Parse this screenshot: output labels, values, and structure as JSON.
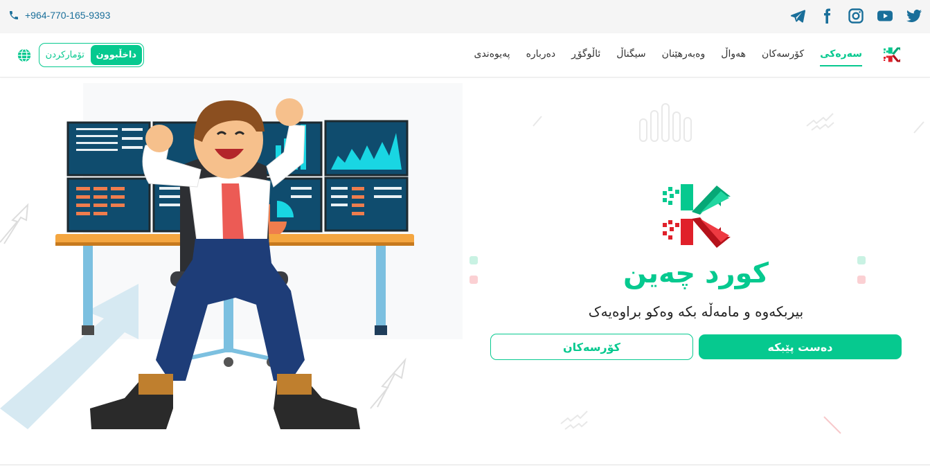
{
  "topbar": {
    "phone": "+964-770-165-9393",
    "socials": [
      "twitter-icon",
      "youtube-icon",
      "instagram-icon",
      "facebook-icon",
      "telegram-icon"
    ]
  },
  "nav": {
    "auth": {
      "login": "داخڵبوون",
      "register": "تۆمارکردن"
    },
    "items": [
      {
        "label": "سەرەکی",
        "active": true
      },
      {
        "label": "کۆرسەکان"
      },
      {
        "label": "هەواڵ"
      },
      {
        "label": "وەبەرهێنان"
      },
      {
        "label": "سیگناڵ"
      },
      {
        "label": "ئاڵوگۆڕ"
      },
      {
        "label": "دەربارە"
      },
      {
        "label": "پەیوەندی"
      }
    ]
  },
  "hero": {
    "brand_name": "کورد چەین",
    "tagline": "بیربکەوە و مامەڵە بکە وەکو براوەیەک",
    "start_button": "دەست پێبکە",
    "courses_button": "کۆرسەکان"
  },
  "colors": {
    "accent": "#06c98f",
    "link": "#1a6f9a",
    "danger": "#e0202a"
  }
}
